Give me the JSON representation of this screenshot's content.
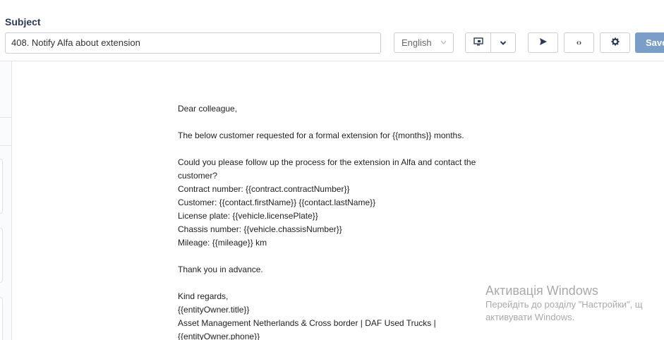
{
  "subject": {
    "label": "Subject",
    "value": "408. Notify Alfa about extension"
  },
  "language": {
    "selected": "English"
  },
  "toolbar": {
    "preview_icon": "monitor-icon",
    "dropdown_icon": "chevron-down-icon",
    "send_icon": "send-icon",
    "code_icon": "code-icon",
    "code_glyph": "‹›",
    "settings_icon": "gear-icon",
    "save_label": "Save"
  },
  "email": {
    "lines": [
      "Dear colleague,",
      "",
      "The below customer requested for a formal extension for {{months}} months.",
      "",
      "Could you please follow up the process for the extension in Alfa and contact the",
      "customer?",
      "Contract number: {{contract.contractNumber}}",
      "Customer: {{contact.firstName}} {{contact.lastName}}",
      "License plate: {{vehicle.licensePlate}}",
      "Chassis number: {{vehicle.chassisNumber}}",
      "Mileage: {{mileage}} km",
      "",
      "Thank you in advance.",
      "",
      "Kind regards,",
      "{{entityOwner.title}}",
      "Asset Management Netherlands & Cross border | DAF Used Trucks |",
      "{{entityOwner.phone}}"
    ]
  },
  "watermark": {
    "title": "Активація Windows",
    "line1": "Перейдіть до розділу \"Настройки\", щ",
    "line2": "активувати Windows."
  },
  "colors": {
    "label": "#2d3a55",
    "save_button": "#7a9ec8",
    "border": "#c9cdd4"
  }
}
